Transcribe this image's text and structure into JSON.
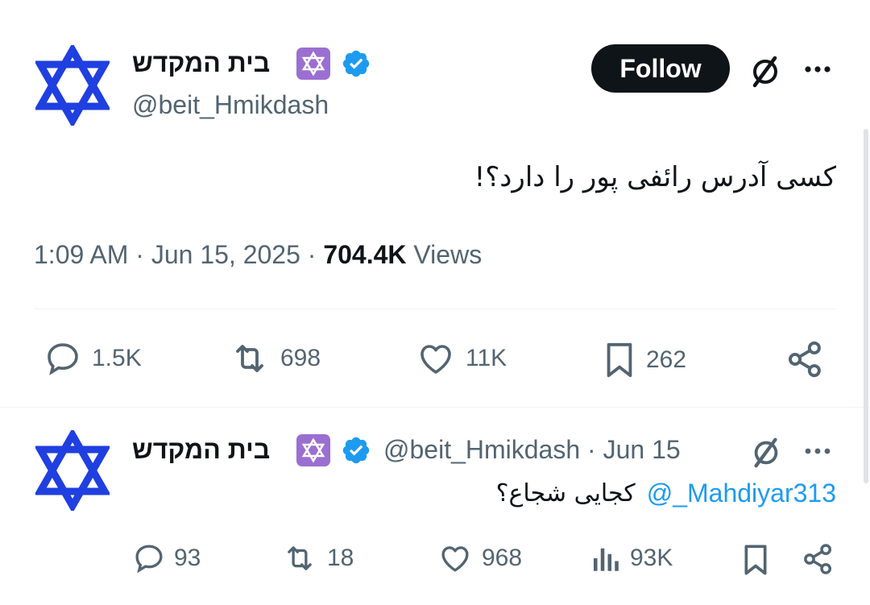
{
  "main_tweet": {
    "display_name": "בית המקדש",
    "handle": "@beit_Hmikdash",
    "follow_label": "Follow",
    "text": "کسی آدرس رائفی پور را دارد؟!",
    "time": "1:09 AM",
    "date": "Jun 15, 2025",
    "separator": "·",
    "views_count": "704.4K",
    "views_label": "Views",
    "replies": "1.5K",
    "retweets": "698",
    "likes": "11K",
    "bookmarks": "262"
  },
  "reply_tweet": {
    "display_name": "בית המקדש",
    "handle": "@beit_Hmikdash",
    "separator": "·",
    "date": "Jun 15",
    "mention": "@_Mahdiyar313",
    "text": "کجایی شجاع؟",
    "replies": "93",
    "retweets": "18",
    "likes": "968",
    "views": "93K"
  },
  "colors": {
    "accent": "#1d9bf0",
    "star": "#1f3fe0",
    "badge_bg": "#9b6fd1",
    "text_secondary": "#536471"
  },
  "icons": [
    "star-of-david-avatar",
    "star-of-david-badge",
    "verified-badge-icon",
    "grok-icon",
    "more-icon",
    "reply-icon",
    "retweet-icon",
    "like-icon",
    "bookmark-icon",
    "share-icon",
    "views-icon"
  ]
}
